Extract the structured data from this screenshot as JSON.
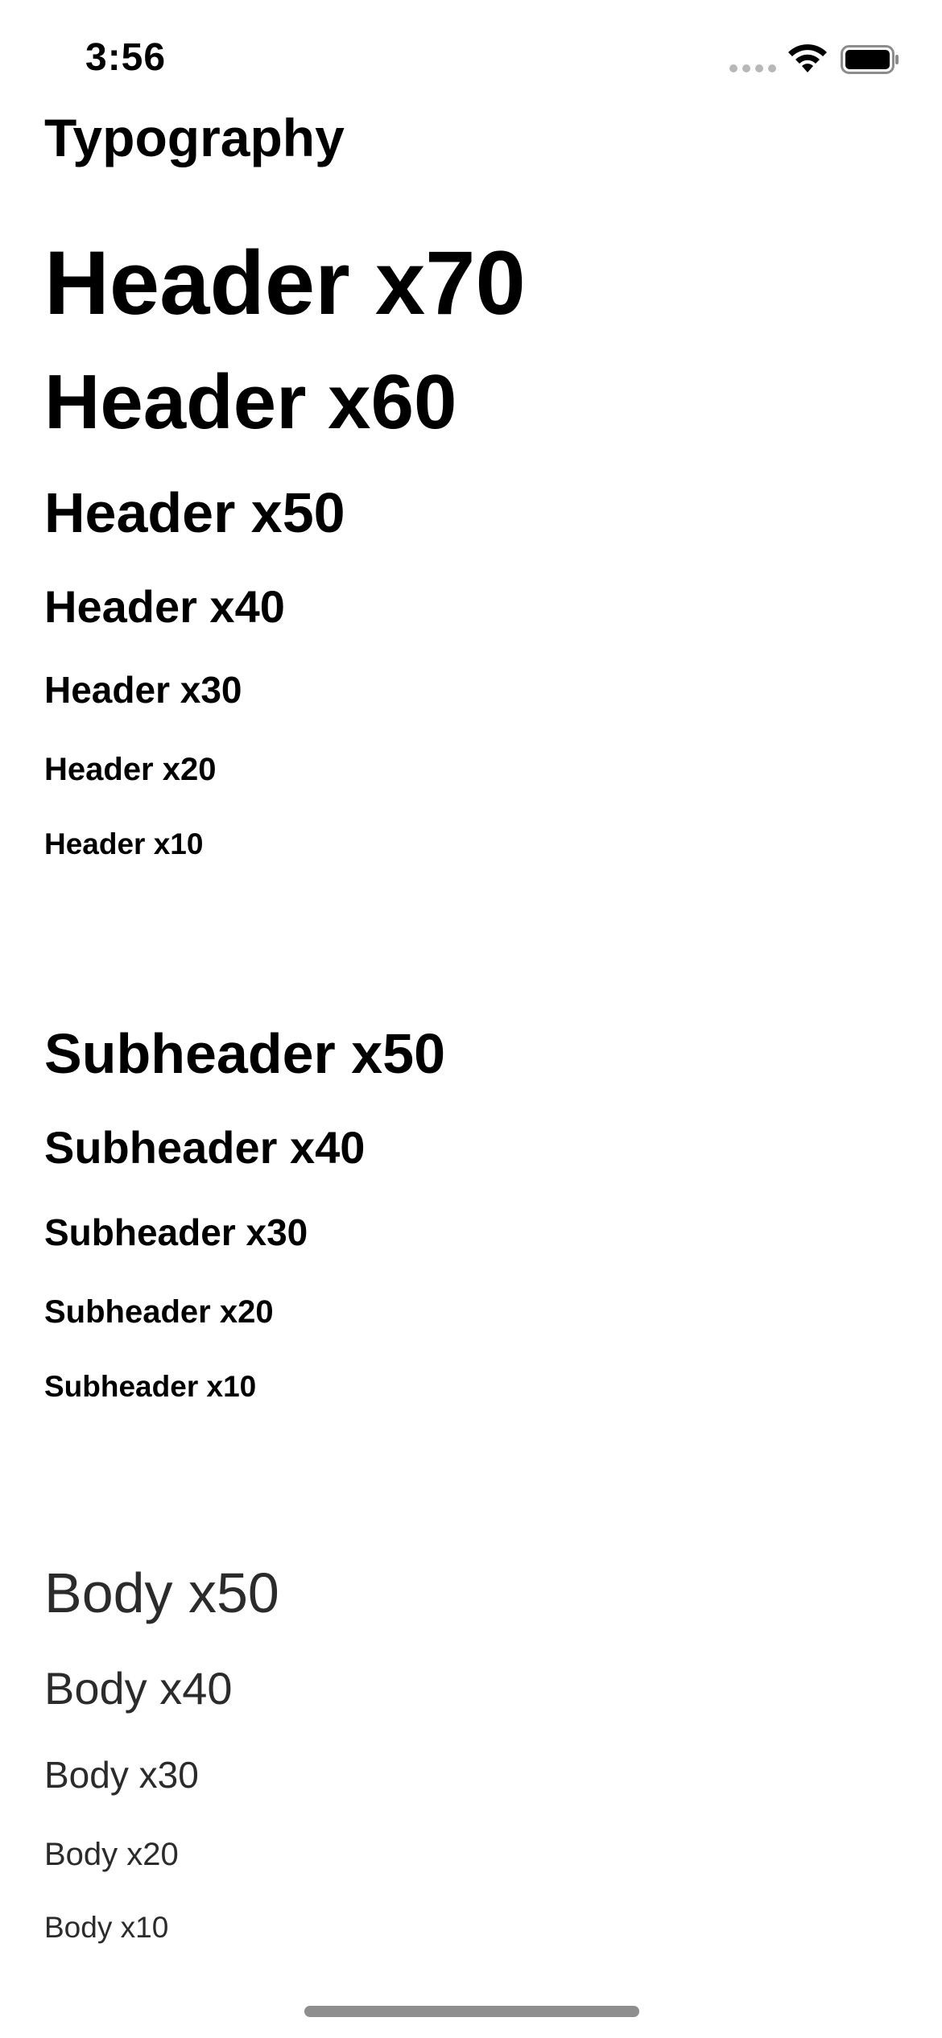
{
  "status_bar": {
    "time": "3:56"
  },
  "icons": {
    "wifi": "wifi-icon",
    "battery": "battery-icon",
    "signal": "cellular-signal-dots-icon"
  },
  "title": "Typography",
  "headers": [
    "Header x70",
    "Header x60",
    "Header x50",
    "Header x40",
    "Header x30",
    "Header x20",
    "Header x10"
  ],
  "subheaders": [
    "Subheader x50",
    "Subheader x40",
    "Subheader x30",
    "Subheader x20",
    "Subheader x10"
  ],
  "body_samples": [
    "Body x50",
    "Body x40",
    "Body x30",
    "Body x20",
    "Body x10"
  ],
  "colors": {
    "text": "#000000",
    "body_text": "#2b2b2b",
    "background": "#ffffff",
    "home_indicator": "#8e8e8e"
  }
}
